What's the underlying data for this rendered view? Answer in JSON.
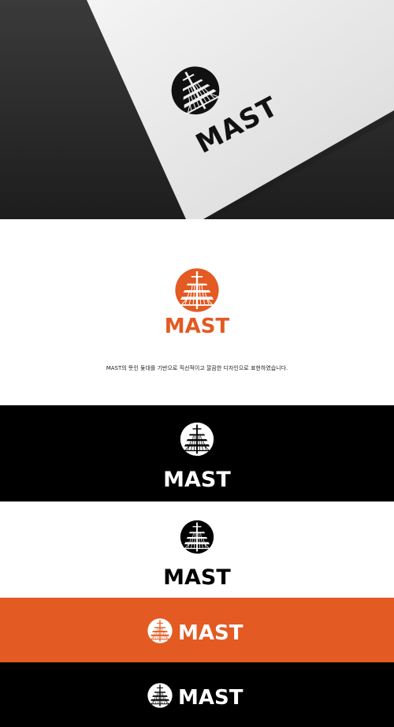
{
  "brand": {
    "name": "MAST",
    "colors": {
      "orange": "#e35a22",
      "black": "#000000",
      "white": "#ffffff",
      "dark_gray": "#2a2a2a"
    }
  },
  "description": "MAST의 뜻인 돛대를 기반으로 직선적이고 깔끔한 디자인으로 표현하였습니다.",
  "variants": [
    {
      "label": "MAST",
      "background": "#000000",
      "foreground": "#ffffff",
      "layout": "stacked"
    },
    {
      "label": "MAST",
      "background": "#ffffff",
      "foreground": "#000000",
      "layout": "stacked"
    },
    {
      "label": "MAST",
      "background": "#e35a22",
      "foreground": "#ffffff",
      "layout": "horizontal"
    },
    {
      "label": "MAST",
      "background": "#000000",
      "foreground": "#ffffff",
      "layout": "horizontal"
    }
  ],
  "icons": [
    "mast-emblem-icon"
  ]
}
